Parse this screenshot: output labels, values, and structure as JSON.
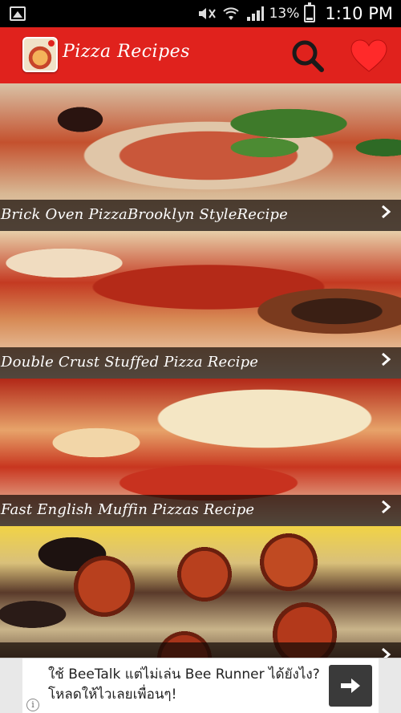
{
  "status_bar": {
    "battery_percent": "13%",
    "time": "1:10 PM",
    "icons": [
      "image-icon",
      "mute-icon",
      "wifi-icon",
      "signal-icon",
      "battery-icon"
    ]
  },
  "app_bar": {
    "title": "Pizza Recipes",
    "logo_icon": "pizza-logo-icon",
    "actions": [
      "search-icon",
      "heart-icon"
    ],
    "accent_color": "#e0221d"
  },
  "recipes": [
    {
      "title": "Brick Oven PizzaBrooklyn StyleRecipe"
    },
    {
      "title": "Double Crust Stuffed Pizza Recipe"
    },
    {
      "title": "Fast English Muffin Pizzas Recipe"
    },
    {
      "title": ""
    }
  ],
  "ad": {
    "text": "ใช้ BeeTalk แต่ไม่เล่น Bee Runner ได้ยังไง? โหลดให้ไวเลยเพื่อนๆ!",
    "button_icon": "arrow-right-icon",
    "info_icon": "info-icon"
  }
}
